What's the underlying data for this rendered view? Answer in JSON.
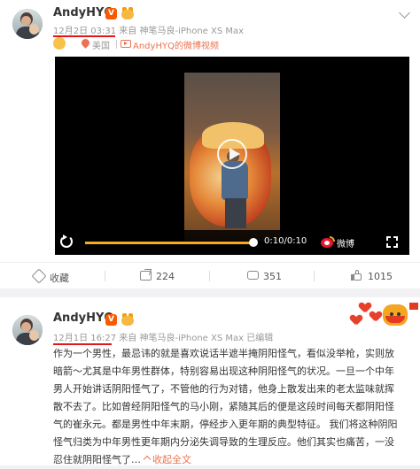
{
  "posts": [
    {
      "username": "AndyHYQ",
      "vip_badge": "V",
      "time": "12月2日 03:31",
      "source": "来自 神笔马良-iPhone XS Max",
      "location": "美国",
      "video_link": "AndyHYQ的微博视频",
      "video": {
        "time_display": "0:10/0:10",
        "watermark": "微博",
        "progress": 1.0
      },
      "actions": {
        "collect": "收藏",
        "repost": "224",
        "comment": "351",
        "like": "1015"
      }
    },
    {
      "username": "AndyHYQ",
      "vip_badge": "V",
      "time": "12月1日 16:27",
      "source": "来自 神笔马良-iPhone XS Max",
      "edited": "已编辑",
      "lines": [
        "作为一个男性，最忌讳的就是喜欢说话半遮半掩阴阳怪气，看似没举枪，实则放",
        "暗箭～尤其是中年男性群体，特别容易出现这种阴阳怪气的状况。一旦一个中年",
        "男人开始讲话阴阳怪气了，不管他的行为对错，他身上散发出来的老太监味就挥",
        "散不去了。比如曾经阴阳怪气的马小刚，紧随其后的便是这段时间每天都阴阳怪",
        "气的崔永元。都是男性中年末期，停经步入更年期的典型特征。 我们将这种阴阳",
        "怪气归类为中年男性更年期内分泌失调导致的生理反应。他们其实也痛苦，一没"
      ],
      "last_line": "忍住就阴阳怪气了…",
      "collapse": "收起全文"
    }
  ]
}
